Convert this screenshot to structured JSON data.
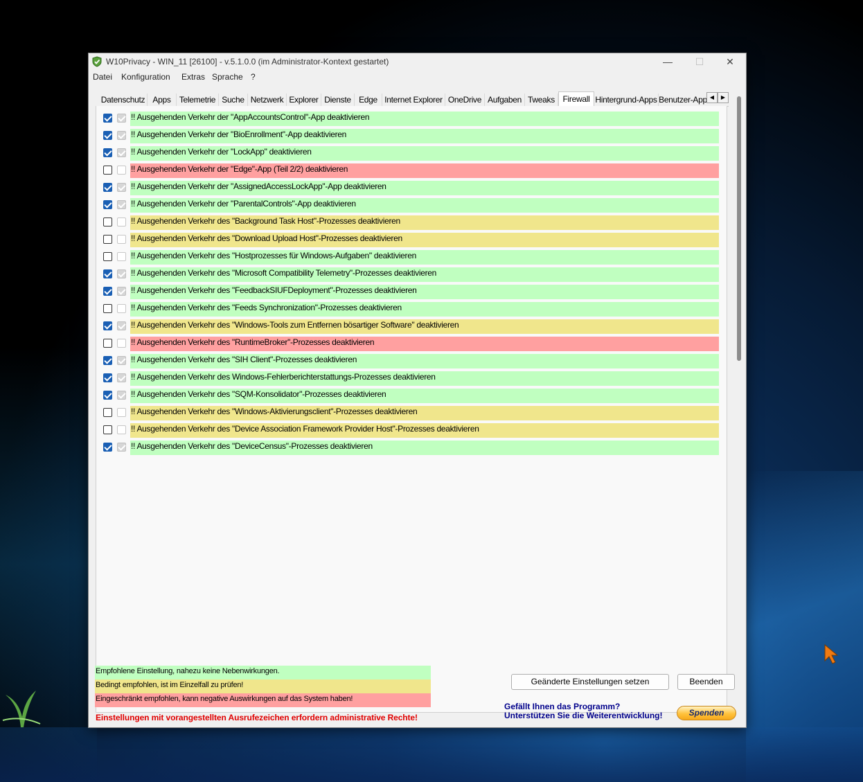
{
  "window": {
    "title": "W10Privacy - WIN_11 [26100]  - v.5.1.0.0 (im Administrator-Kontext gestartet)",
    "minimize_glyph": "—",
    "maximize_glyph": "☐",
    "close_glyph": "✕"
  },
  "menu": [
    {
      "label": "Datei"
    },
    {
      "label": "Konfiguration"
    },
    {
      "label": "Extras"
    },
    {
      "label": "Sprache"
    },
    {
      "label": "?"
    }
  ],
  "tabs": [
    {
      "label": "Datenschutz"
    },
    {
      "label": "Apps"
    },
    {
      "label": "Telemetrie"
    },
    {
      "label": "Suche"
    },
    {
      "label": "Netzwerk"
    },
    {
      "label": "Explorer"
    },
    {
      "label": "Dienste"
    },
    {
      "label": "Edge"
    },
    {
      "label": "Internet Explorer"
    },
    {
      "label": "OneDrive"
    },
    {
      "label": "Aufgaben"
    },
    {
      "label": "Tweaks"
    },
    {
      "label": "Firewall",
      "active": true
    },
    {
      "label": "Hintergrund-Apps"
    },
    {
      "label": "Benutzer-App"
    }
  ],
  "tab_scroll": {
    "left": "◀",
    "right": "▶"
  },
  "settings": [
    {
      "label": "!! Ausgehenden Verkehr der \"AppAccountsControl\"-App deaktivieren",
      "checked": true,
      "recommended": true,
      "level": "green"
    },
    {
      "label": "!! Ausgehenden Verkehr der \"BioEnrollment\"-App deaktivieren",
      "checked": true,
      "recommended": true,
      "level": "green"
    },
    {
      "label": "!! Ausgehenden Verkehr der \"LockApp\" deaktivieren",
      "checked": true,
      "recommended": true,
      "level": "green"
    },
    {
      "label": "!! Ausgehenden Verkehr der \"Edge\"-App (Teil 2/2) deaktivieren",
      "checked": false,
      "recommended": false,
      "level": "red"
    },
    {
      "label": "!! Ausgehenden Verkehr der \"AssignedAccessLockApp\"-App deaktivieren",
      "checked": true,
      "recommended": true,
      "level": "green"
    },
    {
      "label": "!! Ausgehenden Verkehr der \"ParentalControls\"-App deaktivieren",
      "checked": true,
      "recommended": true,
      "level": "green"
    },
    {
      "label": "!! Ausgehenden Verkehr des \"Background Task Host\"-Prozesses deaktivieren",
      "checked": false,
      "recommended": false,
      "level": "yellow"
    },
    {
      "label": "!! Ausgehenden Verkehr des \"Download Upload Host\"-Prozesses deaktivieren",
      "checked": false,
      "recommended": false,
      "level": "yellow"
    },
    {
      "label": "!! Ausgehenden Verkehr des \"Hostprozesses für Windows-Aufgaben\" deaktivieren",
      "checked": false,
      "recommended": false,
      "level": "green"
    },
    {
      "label": "!! Ausgehenden Verkehr des \"Microsoft Compatibility Telemetry\"-Prozesses deaktivieren",
      "checked": true,
      "recommended": true,
      "level": "green"
    },
    {
      "label": "!! Ausgehenden Verkehr des \"FeedbackSIUFDeployment\"-Prozesses deaktivieren",
      "checked": true,
      "recommended": true,
      "level": "green"
    },
    {
      "label": "!! Ausgehenden Verkehr des \"Feeds Synchronization\"-Prozesses deaktivieren",
      "checked": false,
      "recommended": false,
      "level": "green"
    },
    {
      "label": "!! Ausgehenden Verkehr des \"Windows-Tools zum Entfernen bösartiger Software\" deaktivieren",
      "checked": true,
      "recommended": true,
      "level": "yellow"
    },
    {
      "label": "!! Ausgehenden Verkehr des \"RuntimeBroker\"-Prozesses deaktivieren",
      "checked": false,
      "recommended": false,
      "level": "red"
    },
    {
      "label": "!! Ausgehenden Verkehr des \"SIH Client\"-Prozesses deaktivieren",
      "checked": true,
      "recommended": true,
      "level": "green"
    },
    {
      "label": "!! Ausgehenden Verkehr des Windows-Fehlerberichterstattungs-Prozesses deaktivieren",
      "checked": true,
      "recommended": true,
      "level": "green"
    },
    {
      "label": "!! Ausgehenden Verkehr des \"SQM-Konsolidator\"-Prozesses deaktivieren",
      "checked": true,
      "recommended": true,
      "level": "green"
    },
    {
      "label": "!! Ausgehenden Verkehr des \"Windows-Aktivierungsclient\"-Prozesses deaktivieren",
      "checked": false,
      "recommended": false,
      "level": "yellow"
    },
    {
      "label": "!! Ausgehenden Verkehr des \"Device Association Framework Provider Host\"-Prozesses deaktivieren",
      "checked": false,
      "recommended": false,
      "level": "yellow"
    },
    {
      "label": "!! Ausgehenden Verkehr des \"DeviceCensus\"-Prozesses deaktivieren",
      "checked": true,
      "recommended": true,
      "level": "green"
    }
  ],
  "legend": {
    "green": "Empfohlene Einstellung, nahezu keine Nebenwirkungen.",
    "yellow": "Bedingt empfohlen, ist im Einzelfall zu prüfen!",
    "red": "Eingeschränkt empfohlen, kann negative Auswirkungen auf das System haben!",
    "admin_note": "Einstellungen mit vorangestellten Ausrufezeichen erfordern administrative Rechte!"
  },
  "buttons": {
    "apply": "Geänderte Einstellungen setzen",
    "exit": "Beenden",
    "donate": "Spenden"
  },
  "support": {
    "line1": "Gefällt Ihnen das Programm?",
    "line2": "Unterstützen Sie die Weiterentwicklung!"
  },
  "colors": {
    "green": "#c0ffc0",
    "yellow": "#f0e68c",
    "red": "#ffa0a0",
    "checkbox_accent": "#1a5fb4",
    "admin_note": "#e00000",
    "support_text": "#00008b"
  }
}
